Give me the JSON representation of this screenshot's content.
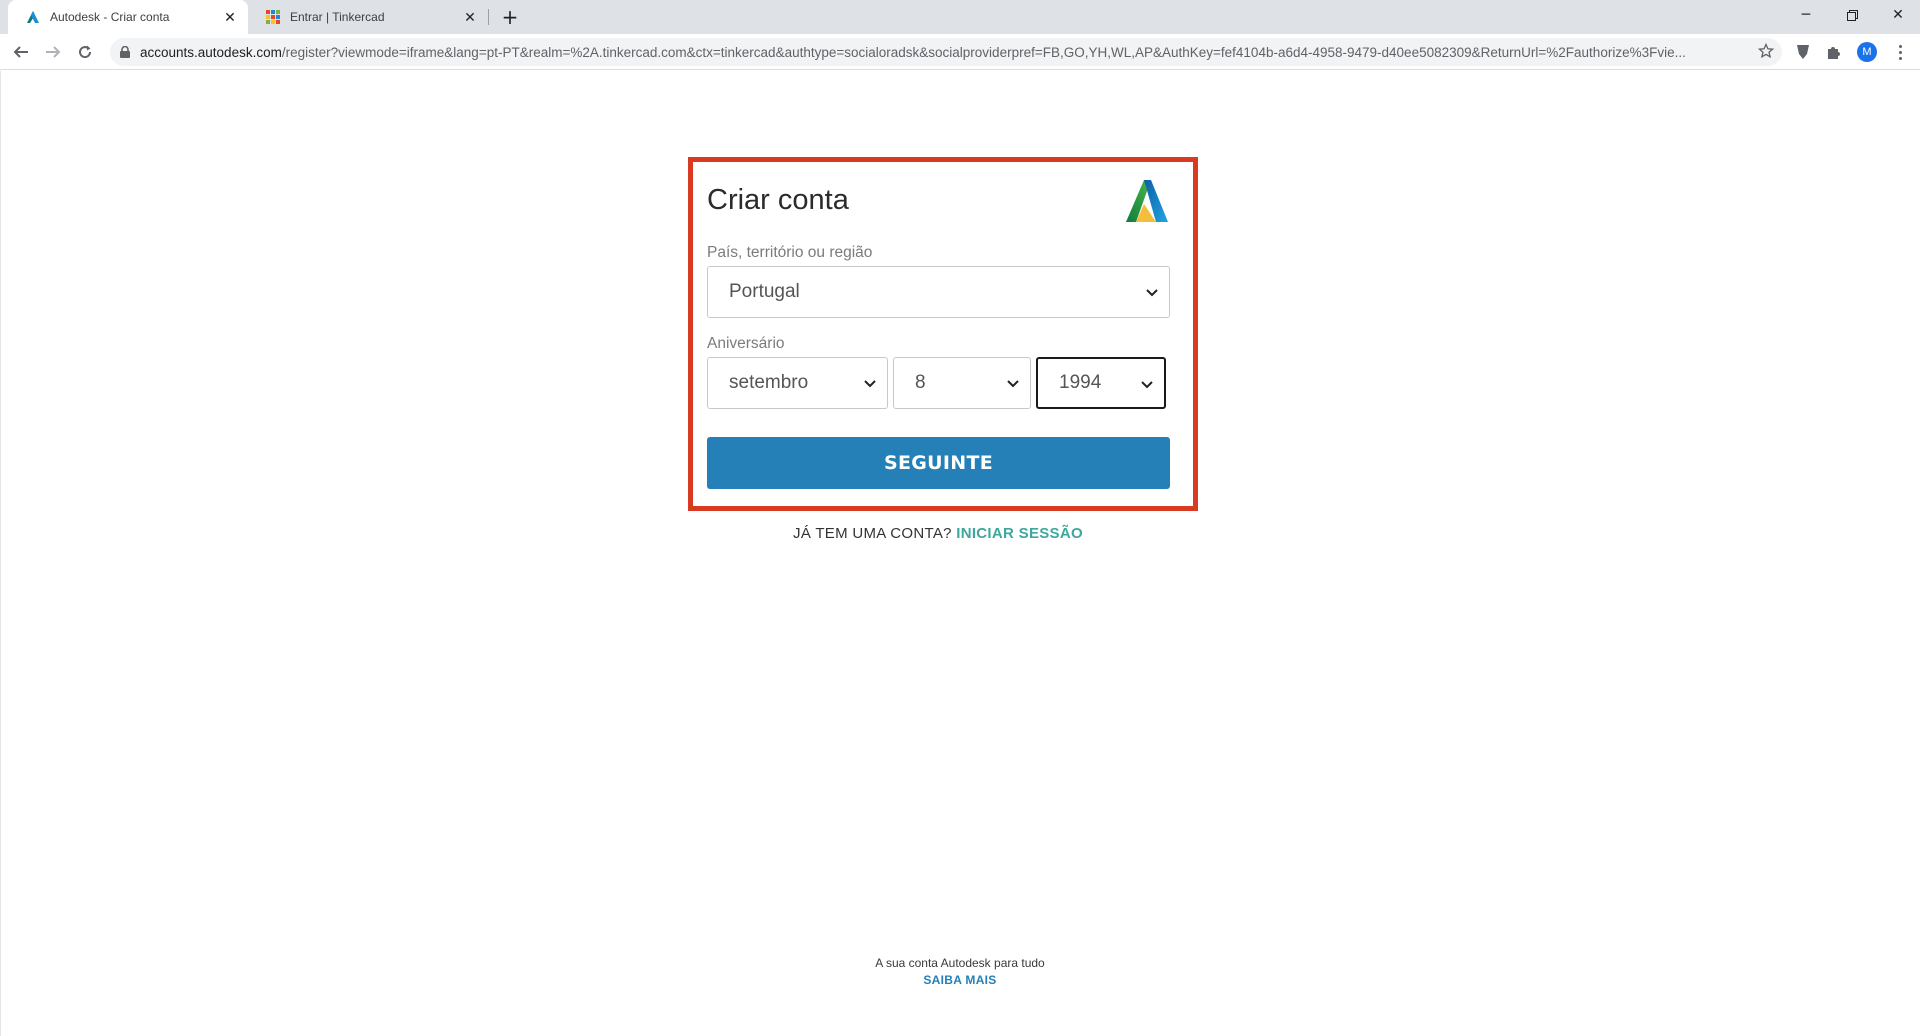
{
  "browser": {
    "tabs": [
      {
        "title": "Autodesk - Criar conta",
        "favicon": "autodesk-logo",
        "active": true
      },
      {
        "title": "Entrar | Tinkercad",
        "favicon": "tinkercad-grid-logo",
        "active": false
      }
    ],
    "url": {
      "host": "accounts.autodesk.com",
      "path": "/register?viewmode=iframe&lang=pt-PT&realm=%2A.tinkercad.com&ctx=tinkercad&authtype=socialoradsk&socialproviderpref=FB,GO,YH,WL,AP&AuthKey=fef4104b-a6d4-4958-9479-d40ee5082309&ReturnUrl=%2Fauthorize%3Fvie..."
    },
    "profile_initial": "M"
  },
  "form": {
    "title": "Criar conta",
    "country_label": "País, território ou região",
    "country_value": "Portugal",
    "birthday_label": "Aniversário",
    "month_value": "setembro",
    "day_value": "8",
    "year_value": "1994",
    "submit_label": "SEGUINTE"
  },
  "signin": {
    "prompt": "JÁ TEM UMA CONTA?",
    "link": "INICIAR SESSÃO"
  },
  "footer": {
    "text": "A sua conta Autodesk para tudo",
    "link": "SAIBA MAIS"
  },
  "colors": {
    "accent": "#2480b7",
    "link_green": "#3ea89e",
    "highlight_border": "#d93a22"
  }
}
